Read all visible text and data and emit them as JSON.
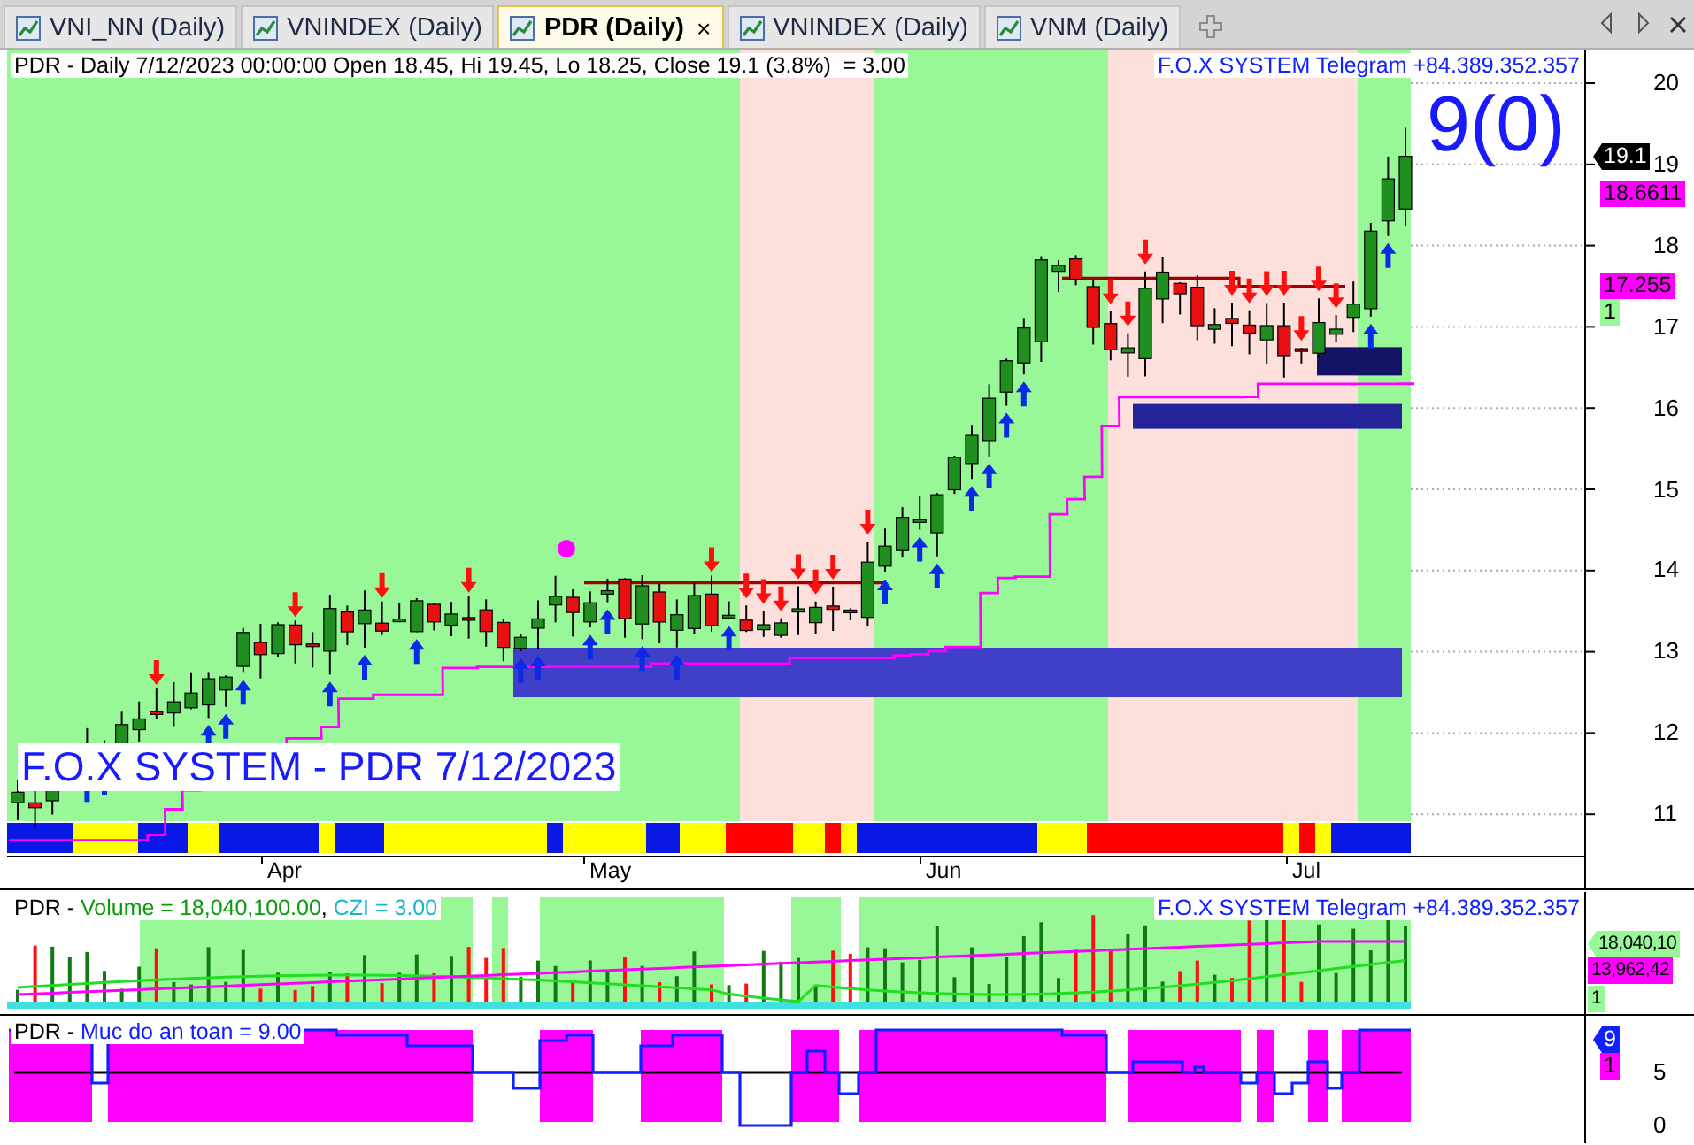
{
  "tabs": [
    {
      "label": "VNI_NN (Daily)",
      "selected": false
    },
    {
      "label": "VNINDEX (Daily)",
      "selected": false
    },
    {
      "label": "PDR (Daily)",
      "selected": true,
      "close": "×"
    },
    {
      "label": "VNINDEX (Daily)",
      "selected": false
    },
    {
      "label": "VNM (Daily)",
      "selected": false
    }
  ],
  "main_panel": {
    "header": [
      {
        "text": "PDR - Daily 7/12/2023 00:00:00 Open 18.45, Hi 19.45, Lo 18.25, Close 19.1 (3.8%)  = 3.00"
      }
    ],
    "signature": "F.O.X SYSTEM Telegram +84.389.352.357",
    "big_label": "9(0)",
    "caption": "F.O.X SYSTEM - PDR 7/12/2023",
    "yticks": [
      "20",
      "19",
      "18",
      "17",
      "16",
      "15",
      "14",
      "13",
      "12",
      "11"
    ],
    "badges": [
      {
        "text": "19.1",
        "kind": "black-pointer"
      },
      {
        "text": "18.6611",
        "kind": "magenta"
      },
      {
        "text": "17.255",
        "kind": "magenta"
      },
      {
        "text": "1",
        "kind": "green"
      }
    ],
    "months": [
      "Apr",
      "May",
      "Jun",
      "Jul"
    ]
  },
  "volume_panel": {
    "header": [
      {
        "text": "PDR",
        "kind": "plain"
      },
      {
        "text": " - ",
        "kind": "plain"
      },
      {
        "text": "Volume = 18,040,100.00",
        "kind": "green"
      },
      {
        "text": ", ",
        "kind": "plain"
      },
      {
        "text": "CZI = 3.00",
        "kind": "cyan"
      }
    ],
    "signature": "F.O.X SYSTEM Telegram +84.389.352.357",
    "badges": [
      {
        "text": "18,040,10",
        "kind": "green-pointer"
      },
      {
        "text": "13,962,42",
        "kind": "magenta"
      },
      {
        "text": "1",
        "kind": "green"
      }
    ]
  },
  "indicator_panel": {
    "header": [
      {
        "text": "PDR",
        "kind": "plain"
      },
      {
        "text": " - ",
        "kind": "plain"
      },
      {
        "text": "Muc do an toan = 9.00",
        "kind": "blue"
      }
    ],
    "badges": [
      {
        "text": "9",
        "kind": "blue-pointer"
      },
      {
        "text": "1",
        "kind": "magenta"
      }
    ],
    "yticks": [
      "5",
      "0"
    ]
  }
}
